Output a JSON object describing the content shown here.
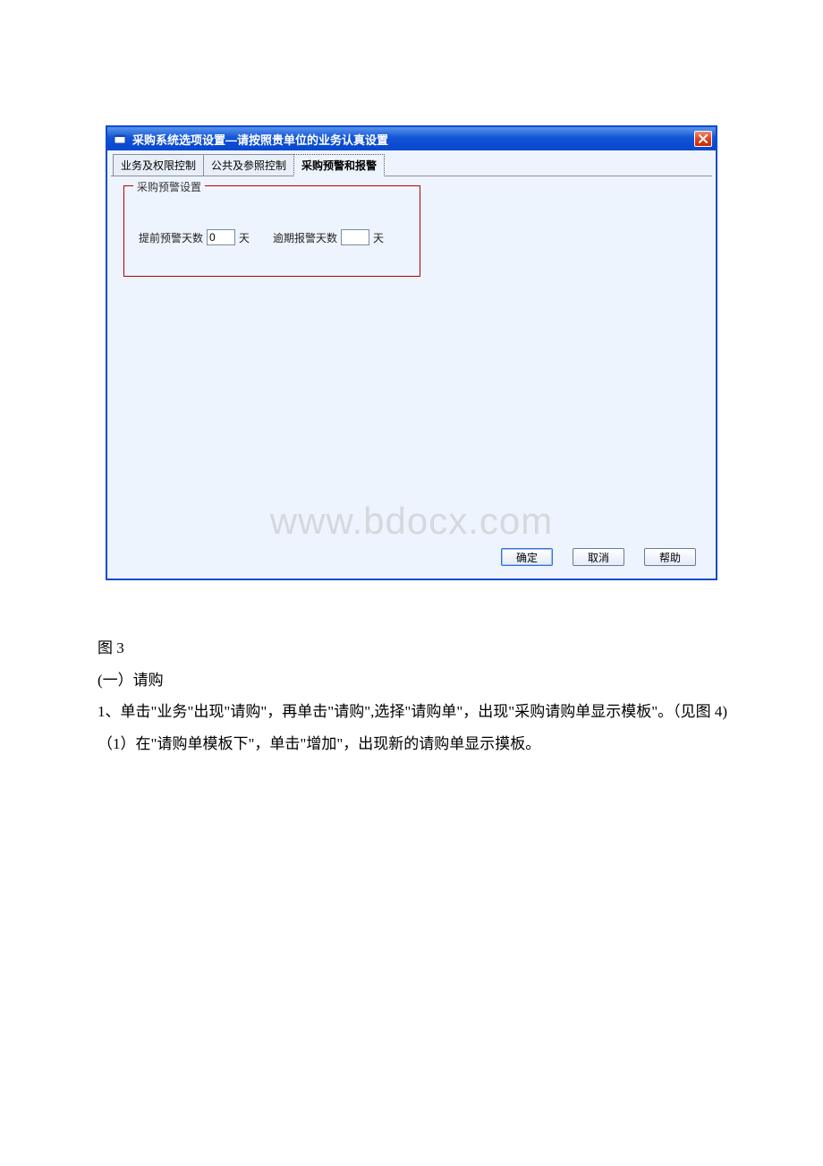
{
  "window": {
    "title": "采购系统选项设置—请按照贵单位的业务认真设置"
  },
  "tabs": {
    "t0": "业务及权限控制",
    "t1": "公共及参照控制",
    "t2": "采购预警和报警"
  },
  "groupbox": {
    "legend": "采购预警设置",
    "advance_label": "提前预警天数",
    "advance_value": "0",
    "advance_unit": "天",
    "overdue_label": "逾期报警天数",
    "overdue_value": "",
    "overdue_unit": "天"
  },
  "watermark": "www.bdocx.com",
  "buttons": {
    "ok": "确定",
    "cancel": "取消",
    "help": "帮助"
  },
  "doc": {
    "fig_label": "图 3",
    "sec_heading": "(一）请购",
    "para1": "1、单击\"业务\"出现\"请购\"，再单击\"请购\",选择\"请购单\"，出现\"采购请购单显示模板\"。（见图 4)",
    "para2": "（1）在\"请购单模板下\"，单击\"增加\"，出现新的请购单显示摸板。"
  }
}
